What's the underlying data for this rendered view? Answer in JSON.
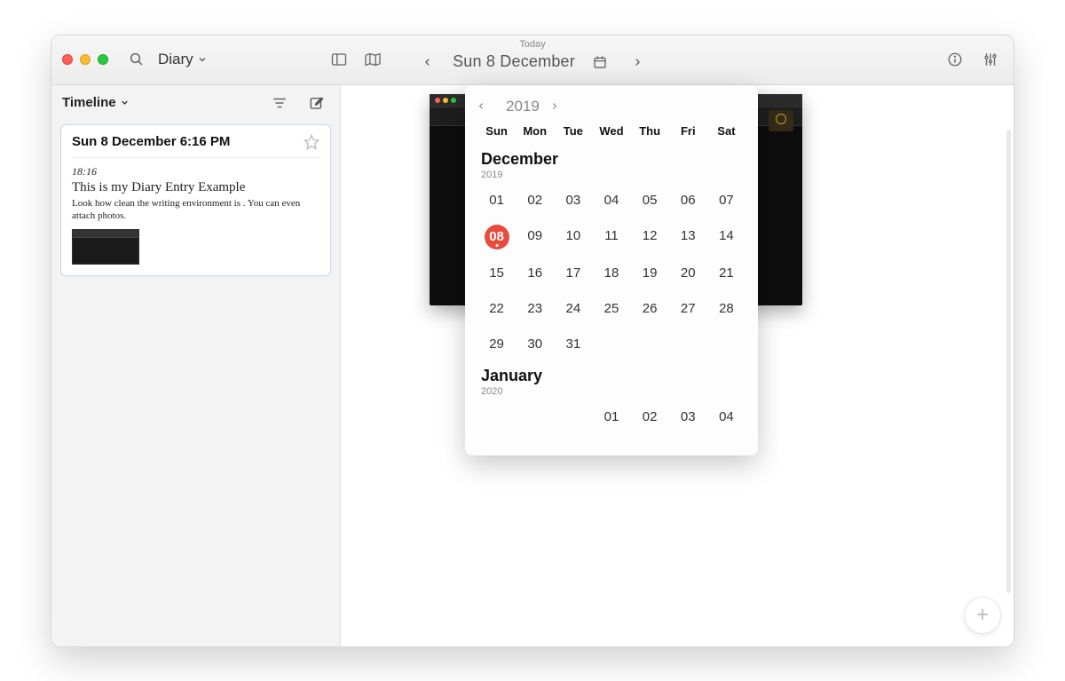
{
  "toolbar": {
    "diary_label": "Diary",
    "today_label": "Today",
    "date_text": "Sun 8 December"
  },
  "sidebar": {
    "title": "Timeline",
    "entry": {
      "header": "Sun 8 December 6:16 PM",
      "time": "18:16",
      "title": "This is my Diary Entry Example",
      "body": "Look how clean the writing environment is . You can even attach photos."
    }
  },
  "calendar": {
    "year": "2019",
    "dow": [
      "Sun",
      "Mon",
      "Tue",
      "Wed",
      "Thu",
      "Fri",
      "Sat"
    ],
    "months": [
      {
        "name": "December",
        "year": "2019",
        "lead": 0,
        "days": 31,
        "today": 8
      },
      {
        "name": "January",
        "year": "2020",
        "lead": 3,
        "days": 4,
        "today": null
      }
    ]
  }
}
